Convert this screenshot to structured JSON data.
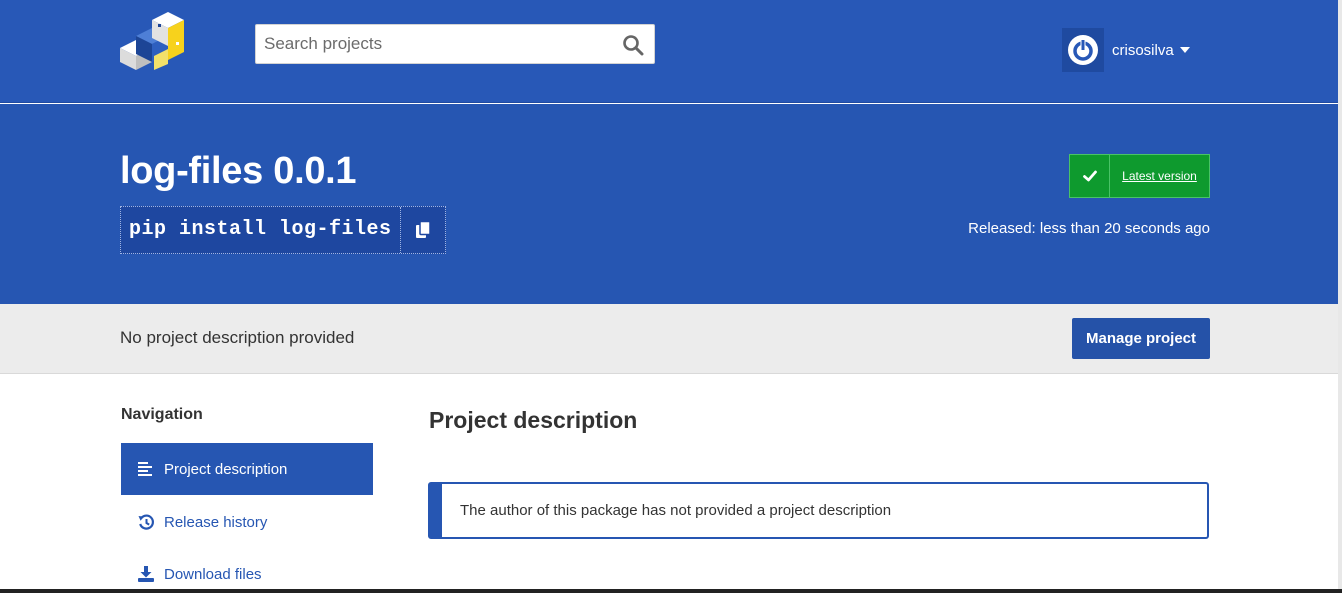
{
  "header": {
    "search": {
      "placeholder": "Search projects",
      "value": ""
    },
    "user": {
      "name": "crisosilva"
    }
  },
  "project": {
    "title": "log-files 0.0.1",
    "pip_command": "pip install log-files",
    "latest_label": "Latest version",
    "released": "Released: less than 20 seconds ago",
    "summary": "No project description provided",
    "manage_label": "Manage project"
  },
  "navigation": {
    "title": "Navigation",
    "items": [
      {
        "label": "Project description",
        "icon": "align-left-icon",
        "active": true
      },
      {
        "label": "Release history",
        "icon": "history-icon",
        "active": false
      },
      {
        "label": "Download files",
        "icon": "download-icon",
        "active": false
      }
    ]
  },
  "main": {
    "section_title": "Project description",
    "callout": "The author of this package has not provided a project description"
  },
  "colors": {
    "brand_blue": "#2656b2",
    "success_green": "#0e9a2e"
  }
}
